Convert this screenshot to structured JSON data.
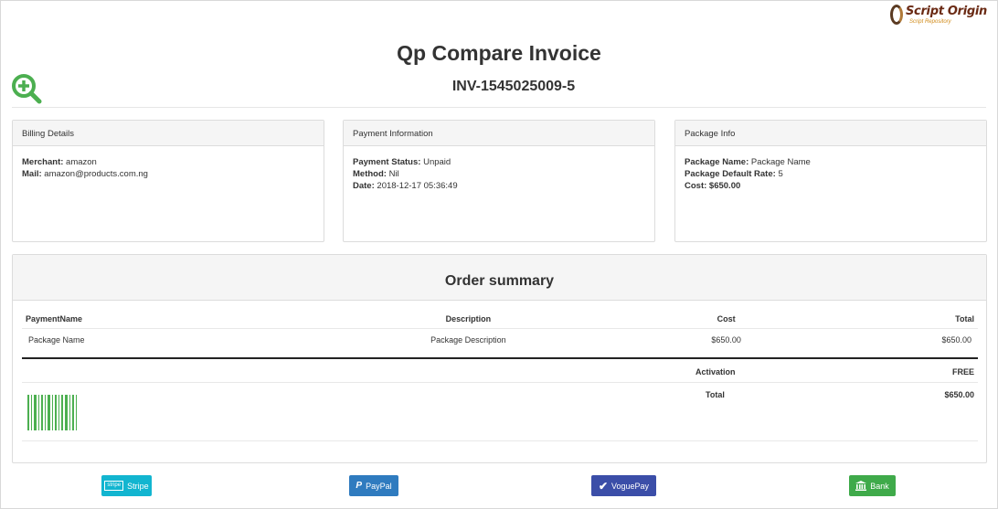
{
  "brand": {
    "name": "Script Origin",
    "tagline": "Script Repository"
  },
  "header": {
    "title": "Qp Compare Invoice",
    "invoice_number": "INV-1545025009-5"
  },
  "billing": {
    "title": "Billing Details",
    "merchant_label": "Merchant:",
    "merchant": "amazon",
    "mail_label": "Mail:",
    "mail": "amazon@products.com.ng"
  },
  "payment": {
    "title": "Payment Information",
    "status_label": "Payment Status:",
    "status": "Unpaid",
    "method_label": "Method:",
    "method": "Nil",
    "date_label": "Date:",
    "date": "2018-12-17 05:36:49"
  },
  "package": {
    "title": "Package Info",
    "name_label": "Package Name:",
    "name": "Package Name",
    "rate_label": "Package Default Rate:",
    "rate": "5",
    "cost_label": "Cost:",
    "cost": "$650.00"
  },
  "summary": {
    "title": "Order summary",
    "columns": [
      "PaymentName",
      "Description",
      "Cost",
      "Total"
    ],
    "rows": [
      {
        "name": "Package Name",
        "description": "Package Description",
        "cost": "$650.00",
        "total": "$650.00"
      }
    ],
    "activation_label": "Activation",
    "activation_value": "FREE",
    "total_label": "Total",
    "total_value": "$650.00"
  },
  "buttons": {
    "stripe": {
      "icon_text": "stripe",
      "label": "Stripe",
      "color": "#12b5d0"
    },
    "paypal": {
      "icon_text": "P",
      "label": "PayPal",
      "color": "#2f7bbf"
    },
    "voguepay": {
      "label": "VoguePay",
      "color": "#3b4ea8"
    },
    "bank": {
      "label": "Bank",
      "color": "#3faa4a"
    }
  },
  "colors": {
    "zoom_icon": "#4caf50",
    "barcode": "#4caf50"
  }
}
